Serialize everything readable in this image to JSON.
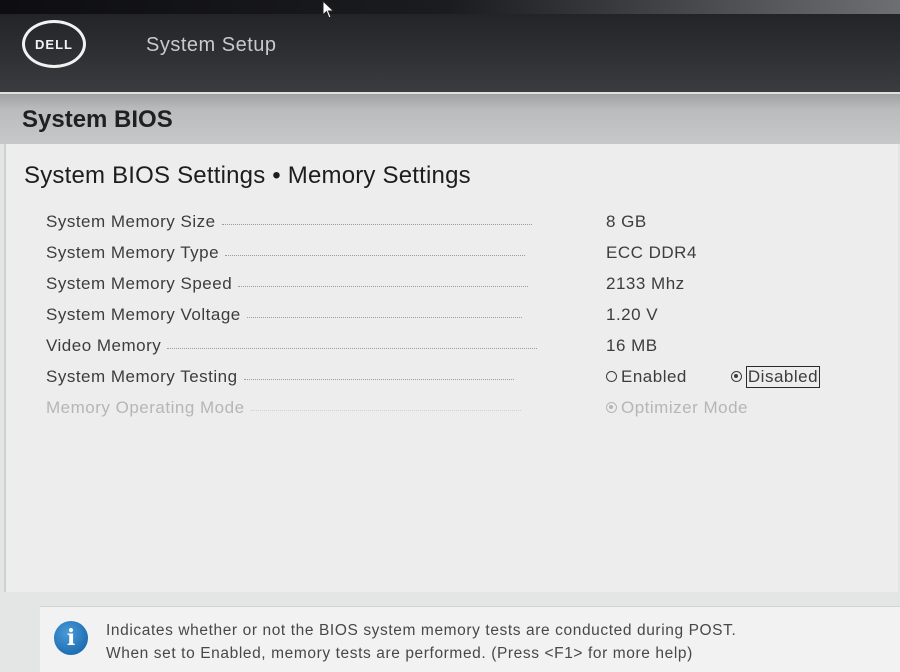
{
  "header": {
    "logo_text": "DELL",
    "app_title": "System Setup"
  },
  "section": {
    "title": "System BIOS"
  },
  "page": {
    "breadcrumb": "System BIOS Settings • Memory Settings"
  },
  "settings": [
    {
      "label": "System Memory Size",
      "value": "8 GB"
    },
    {
      "label": "System Memory Type",
      "value": "ECC DDR4"
    },
    {
      "label": "System Memory Speed",
      "value": "2133 Mhz"
    },
    {
      "label": "System Memory Voltage",
      "value": "1.20 V"
    },
    {
      "label": "Video Memory",
      "value": "16 MB"
    }
  ],
  "memory_testing": {
    "label": "System Memory Testing",
    "options": [
      "Enabled",
      "Disabled"
    ],
    "selected": "Disabled"
  },
  "operating_mode": {
    "label": "Memory Operating Mode",
    "options": [
      "Optimizer Mode"
    ],
    "selected": "Optimizer Mode",
    "enabled": false
  },
  "help": {
    "icon": "info-icon",
    "line1": "Indicates whether or not the BIOS system memory tests are conducted during POST.",
    "line2": "When set to Enabled, memory tests are performed. (Press <F1> for more help)"
  },
  "colors": {
    "header_bg": "#2e3034",
    "section_bar": "#bcbebf",
    "panel_bg": "#ecedec",
    "info_blue": "#1f6fb4"
  }
}
